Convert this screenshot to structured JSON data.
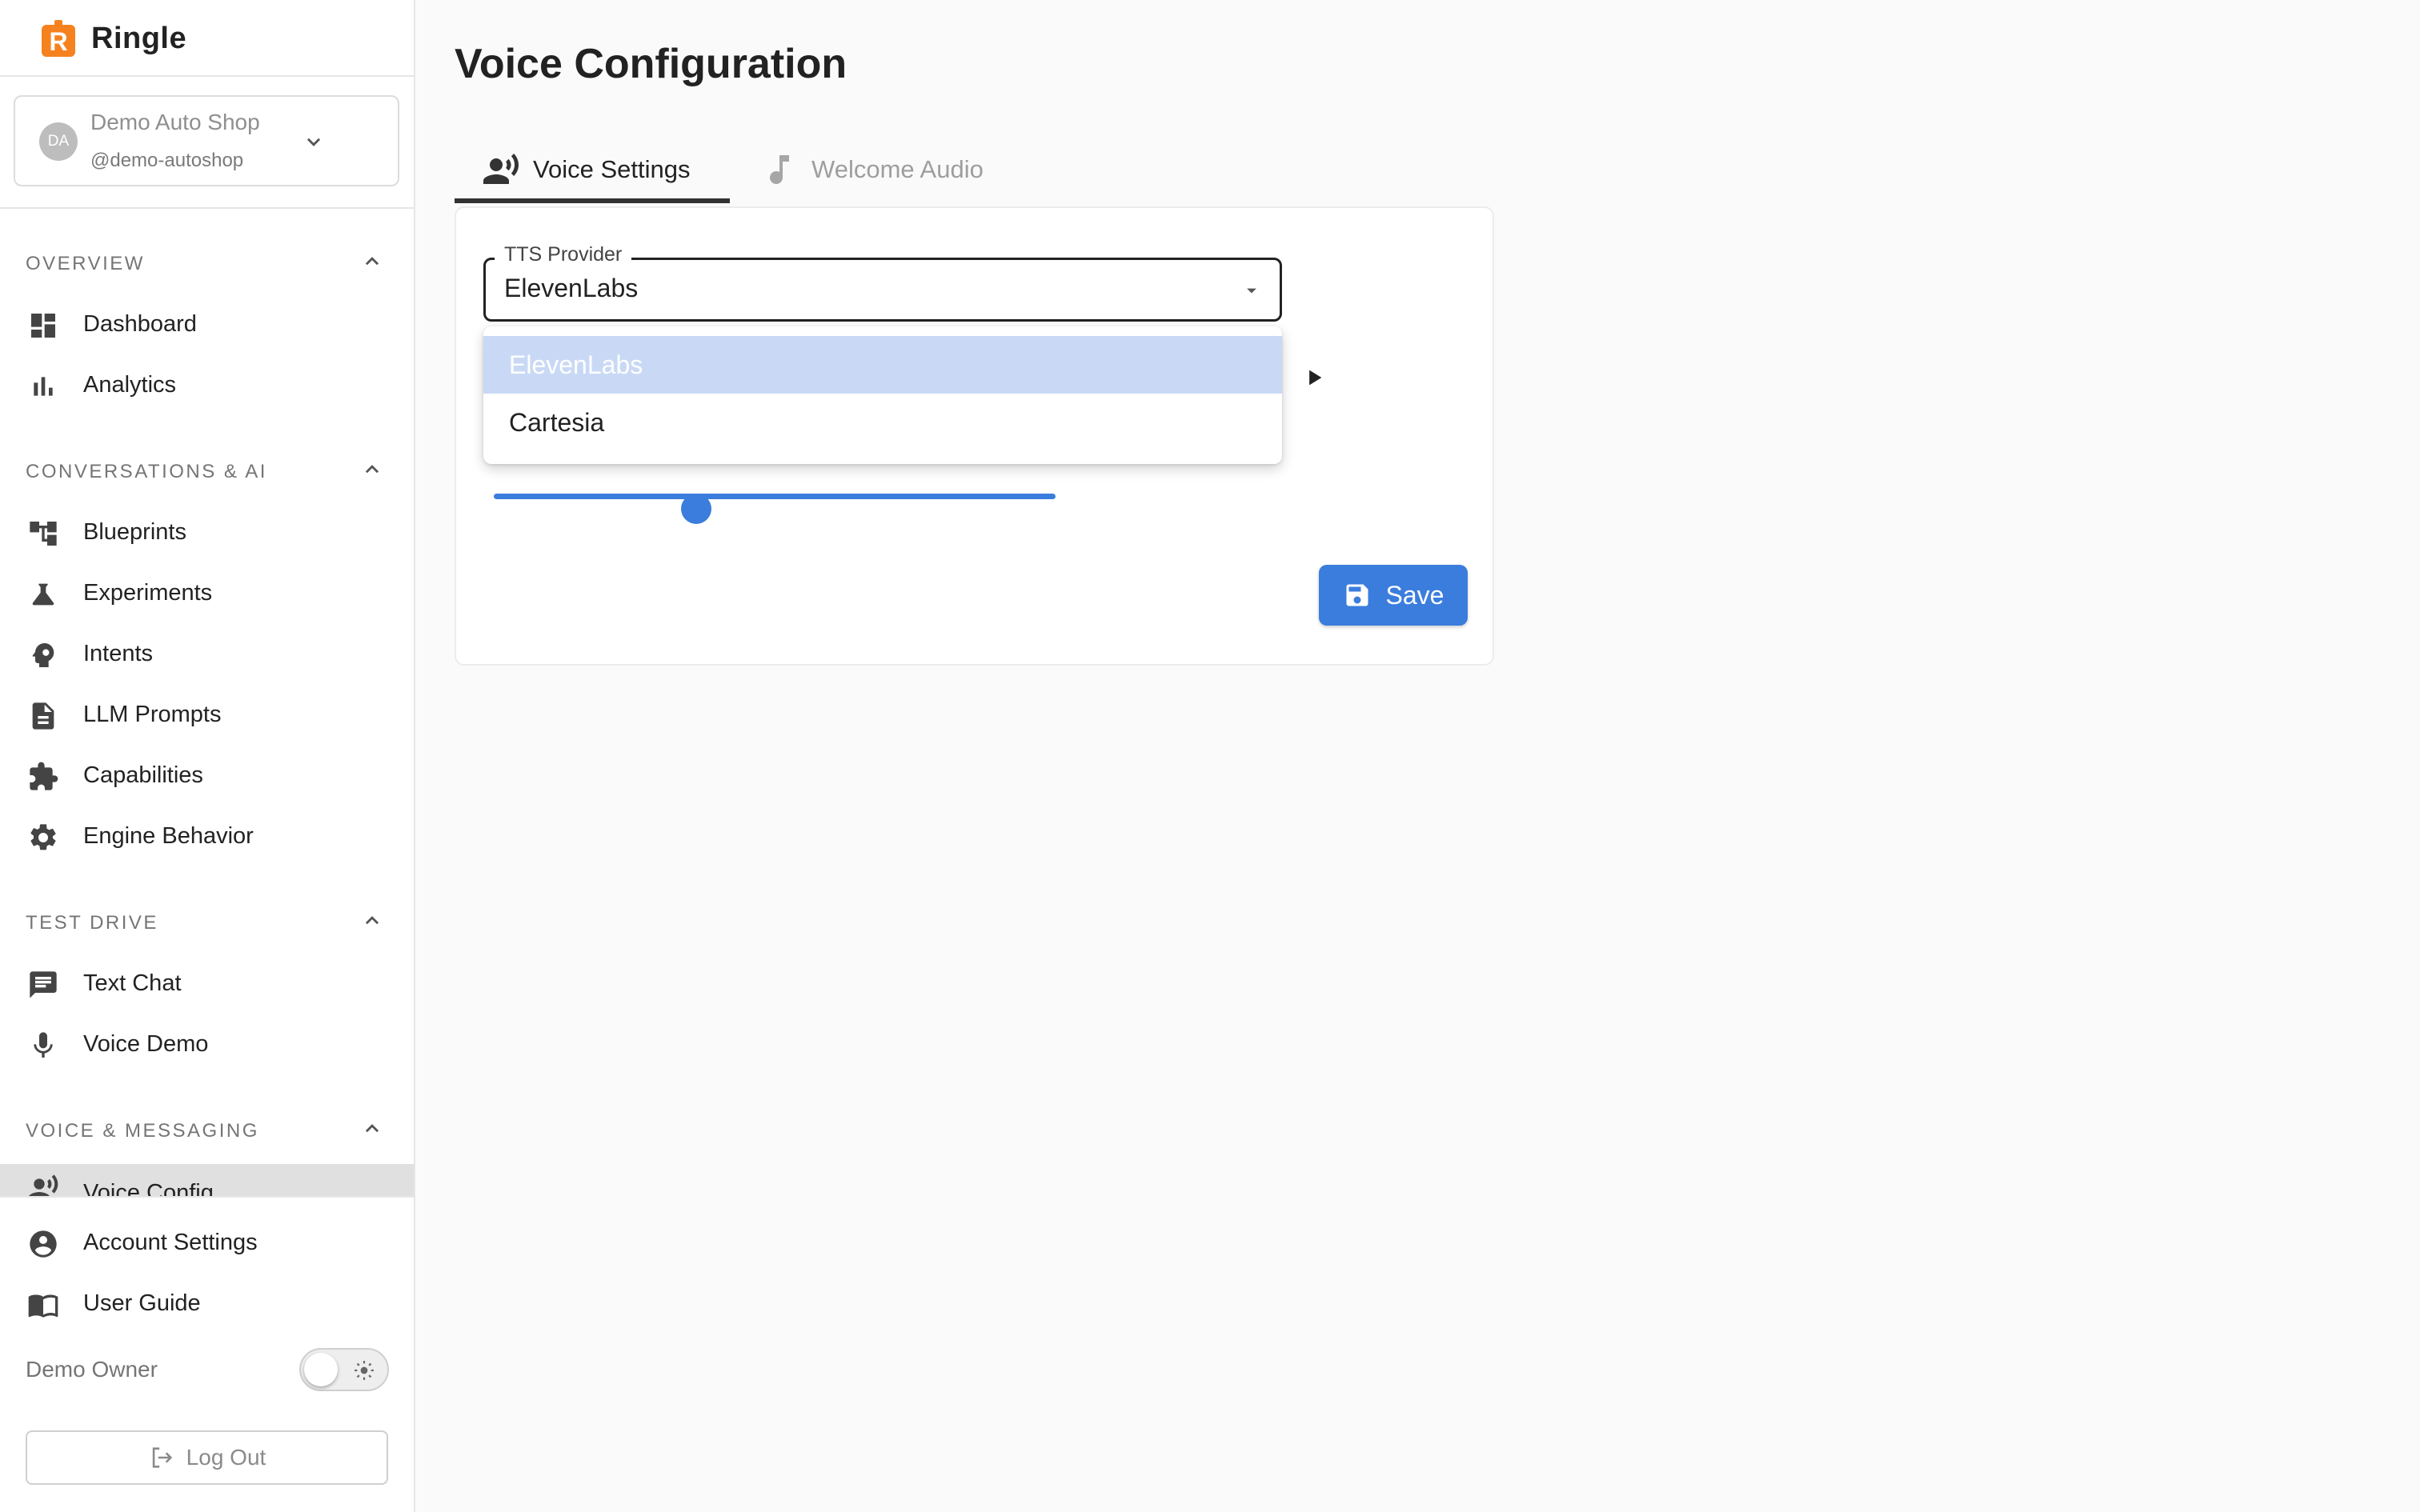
{
  "app": {
    "name": "Ringle",
    "logo_letter": "R"
  },
  "account": {
    "initials": "DA",
    "name": "Demo Auto Shop",
    "handle": "@demo-autoshop"
  },
  "sidebar": {
    "sections": [
      {
        "title": "OVERVIEW",
        "items": [
          {
            "label": "Dashboard",
            "icon": "dashboard-icon"
          },
          {
            "label": "Analytics",
            "icon": "bar-chart-icon"
          }
        ]
      },
      {
        "title": "CONVERSATIONS & AI",
        "items": [
          {
            "label": "Blueprints",
            "icon": "blueprint-icon"
          },
          {
            "label": "Experiments",
            "icon": "flask-icon"
          },
          {
            "label": "Intents",
            "icon": "brain-icon"
          },
          {
            "label": "LLM Prompts",
            "icon": "document-icon"
          },
          {
            "label": "Capabilities",
            "icon": "puzzle-icon"
          },
          {
            "label": "Engine Behavior",
            "icon": "gear-icon"
          }
        ]
      },
      {
        "title": "TEST DRIVE",
        "items": [
          {
            "label": "Text Chat",
            "icon": "chat-icon"
          },
          {
            "label": "Voice Demo",
            "icon": "microphone-icon"
          }
        ]
      },
      {
        "title": "VOICE & MESSAGING",
        "items": [
          {
            "label": "Voice Config",
            "icon": "voice-icon",
            "active": true
          }
        ]
      }
    ],
    "footer_items": [
      {
        "label": "Account Settings",
        "icon": "account-circle-icon"
      },
      {
        "label": "User Guide",
        "icon": "book-icon"
      }
    ],
    "owner_label": "Demo Owner",
    "logout_label": "Log Out"
  },
  "main": {
    "title": "Voice Configuration",
    "tabs": [
      {
        "label": "Voice Settings",
        "active": true
      },
      {
        "label": "Welcome Audio",
        "active": false
      }
    ],
    "tts": {
      "label": "TTS Provider",
      "value": "ElevenLabs",
      "options": [
        {
          "label": "ElevenLabs",
          "selected": true
        },
        {
          "label": "Cartesia",
          "selected": false
        }
      ]
    },
    "slider_value": 0.36,
    "save_label": "Save"
  },
  "colors": {
    "accent": "#3b7ddd",
    "logo": "#f5821f",
    "selected_option": "#c9d9f5"
  }
}
